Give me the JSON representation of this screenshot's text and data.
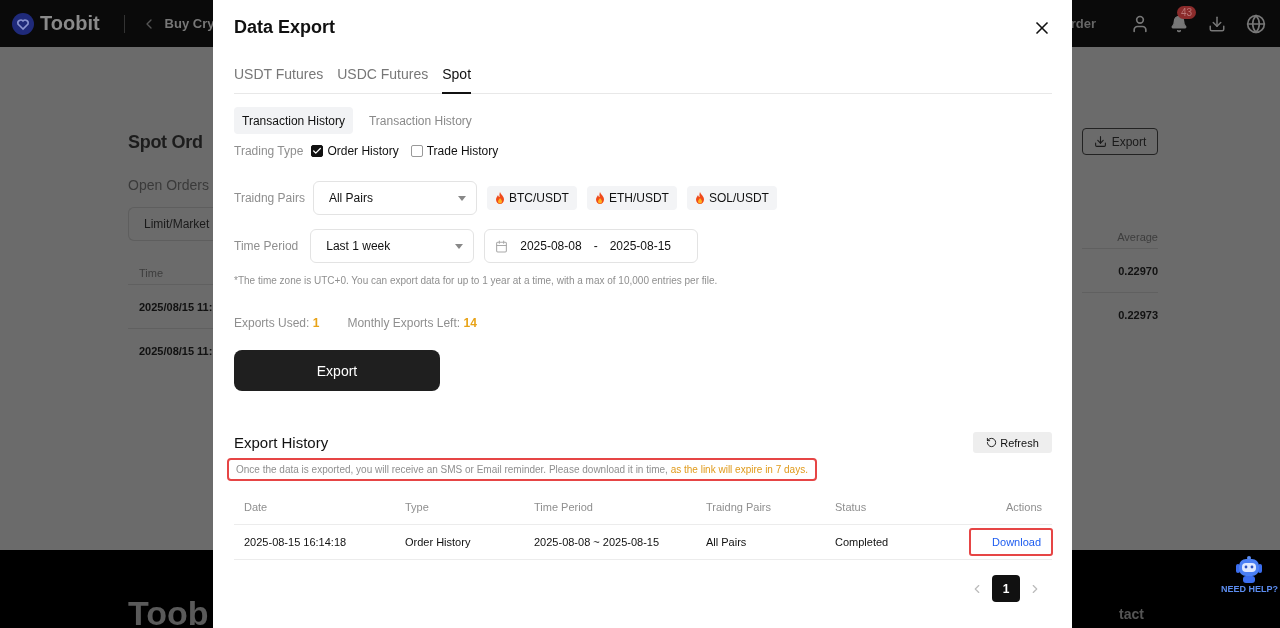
{
  "header": {
    "brand": "Toobit",
    "back_link": "Buy Cry",
    "menu": "rder",
    "notification_count": "43"
  },
  "page": {
    "title": "Spot Ord",
    "tab": "Open Orders",
    "filter": "Limit/Market",
    "export_button": "Export",
    "time_column": "Time",
    "average_column": "Average",
    "rows": [
      {
        "time": "2025/08/15 11:",
        "average": "0.22970"
      },
      {
        "time": "2025/08/15 11:",
        "average": "0.22973"
      }
    ]
  },
  "footer": {
    "brand": "Toob",
    "link": "tact",
    "help": "NEED HELP?"
  },
  "modal": {
    "title": "Data Export",
    "tabs": [
      {
        "label": "USDT Futures",
        "selected": false
      },
      {
        "label": "USDC Futures",
        "selected": false
      },
      {
        "label": "Spot",
        "selected": true
      }
    ],
    "subtabs": [
      {
        "label": "Transaction History",
        "selected": true
      },
      {
        "label": "Transaction History",
        "selected": false
      }
    ],
    "trading_type": {
      "label": "Trading Type",
      "options": [
        {
          "label": "Order History",
          "checked": true
        },
        {
          "label": "Trade History",
          "checked": false
        }
      ]
    },
    "pairs": {
      "label": "Traidng Pairs",
      "select": "All Pairs",
      "chips": [
        "BTC/USDT",
        "ETH/USDT",
        "SOL/USDT"
      ]
    },
    "period": {
      "label": "Time Period",
      "select": "Last 1 week",
      "start": "2025-08-08",
      "separator": "-",
      "end": "2025-08-15"
    },
    "note": "*The time zone is UTC+0. You can export data for up to 1 year at a time, with a max of 10,000 entries per file.",
    "quota": [
      {
        "label": "Exports Used:",
        "value": "1"
      },
      {
        "label": "Monthly Exports Left:",
        "value": "14"
      }
    ],
    "export_button": "Export",
    "history": {
      "title": "Export History",
      "refresh": "Refresh",
      "notice": "Once the data is exported, you will receive an SMS or Email reminder. Please download it in time, ",
      "notice_highlight": "as the link will expire in 7 days.",
      "notice_marked": true,
      "columns": [
        "Date",
        "Type",
        "Time Period",
        "Traidng Pairs",
        "Status",
        "Actions"
      ],
      "rows": [
        {
          "cells": [
            "2025-08-15 16:14:18",
            "Order History",
            "2025-08-08 ~ 2025-08-15",
            "All Pairs",
            "Completed"
          ],
          "action": "Download",
          "action_marked": true
        }
      ]
    },
    "pagination": {
      "pages": [
        {
          "label": "1",
          "selected": true
        }
      ]
    }
  }
}
